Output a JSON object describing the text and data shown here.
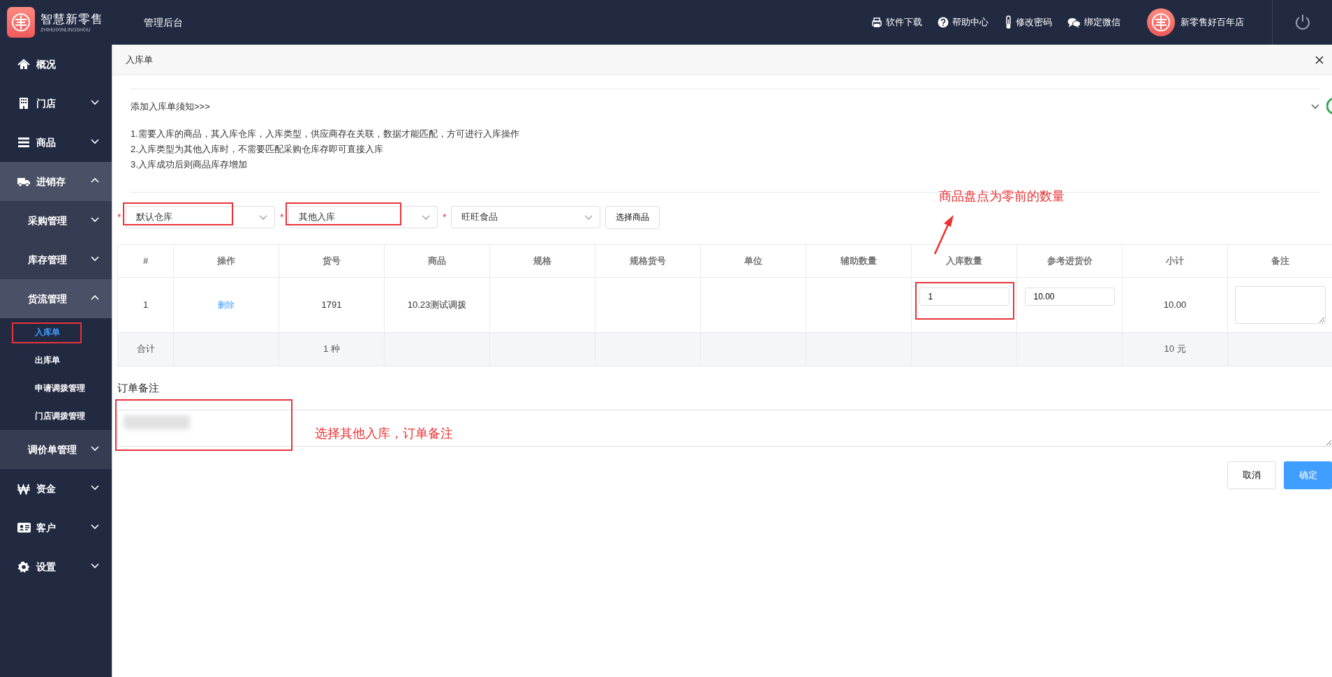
{
  "header": {
    "logo_title": "智慧新零售",
    "logo_subtitle": "ZHIHUIXINLINGSHOU",
    "section": "管理后台",
    "actions": [
      {
        "label": "软件下载"
      },
      {
        "label": "帮助中心"
      },
      {
        "label": "修改密码"
      },
      {
        "label": "绑定微信"
      }
    ],
    "shop_name": "新零售好百年店"
  },
  "sidebar": {
    "items": [
      {
        "kind": "link",
        "label": "概况",
        "selected": false
      },
      {
        "kind": "menu",
        "label": "门店",
        "expanded": false
      },
      {
        "kind": "menu",
        "label": "商品",
        "expanded": false
      },
      {
        "kind": "menu",
        "label": "进销存",
        "expanded": true,
        "children": [
          {
            "kind": "menu",
            "label": "采购管理",
            "expanded": false
          },
          {
            "kind": "menu",
            "label": "库存管理",
            "expanded": false
          },
          {
            "kind": "menu",
            "label": "货流管理",
            "expanded": true,
            "children": [
              {
                "kind": "link",
                "label": "入库单",
                "selected": true,
                "highlighted": true
              },
              {
                "kind": "link",
                "label": "出库单",
                "selected": false,
                "highlighted": false
              },
              {
                "kind": "link",
                "label": "申请调拨管理",
                "selected": false,
                "highlighted": false
              },
              {
                "kind": "link",
                "label": "门店调拨管理",
                "selected": false,
                "highlighted": false
              }
            ]
          },
          {
            "kind": "menu",
            "label": "调价单管理",
            "expanded": false
          }
        ]
      },
      {
        "kind": "menu",
        "label": "资金",
        "expanded": false
      },
      {
        "kind": "menu",
        "label": "客户",
        "expanded": false
      },
      {
        "kind": "menu",
        "label": "设置",
        "expanded": false
      }
    ]
  },
  "tab": {
    "title": "入库单"
  },
  "notice": {
    "title": "添加入库单须知>>>",
    "expanded": true,
    "lines": [
      "1.需要入库的商品，其入库仓库，入库类型，供应商存在关联，数据才能匹配，方可进行入库操作",
      "2.入库类型为其他入库时，不需要匹配采购仓库存即可直接入库",
      "3.入库成功后则商品库存增加"
    ]
  },
  "filters": [
    {
      "marker": "*",
      "value": "默认仓库",
      "highlighted": true
    },
    {
      "marker": "*",
      "value": "其他入库",
      "highlighted": true
    },
    {
      "marker": "*",
      "value": "旺旺食品",
      "highlighted": false
    }
  ],
  "select_button": "选择商品",
  "table": {
    "columns": [
      "#",
      "操作",
      "货号",
      "商品",
      "规格",
      "规格货号",
      "单位",
      "辅助数量",
      "入库数量",
      "参考进货价",
      "小计",
      "备注"
    ],
    "rows": [
      {
        "index": "1",
        "action": "删除",
        "code": "1791",
        "product": "10.23测试调拨",
        "quantity": "1",
        "quantity_highlighted": true,
        "price": "10.00",
        "subtotal": "10.00"
      }
    ],
    "total": {
      "label": "合计",
      "code": "1 种",
      "subtotal": "10 元"
    }
  },
  "remark": {
    "label": "订单备注",
    "redacted": true,
    "highlighted": true
  },
  "buttons": [
    {
      "label": "取消",
      "kind": "default"
    },
    {
      "label": "确定",
      "kind": "primary"
    }
  ],
  "annotations": [
    {
      "text": "商品盘点为零前的数量",
      "arrow": true
    },
    {
      "text": "选择其他入库，订单备注",
      "arrow": false
    }
  ]
}
